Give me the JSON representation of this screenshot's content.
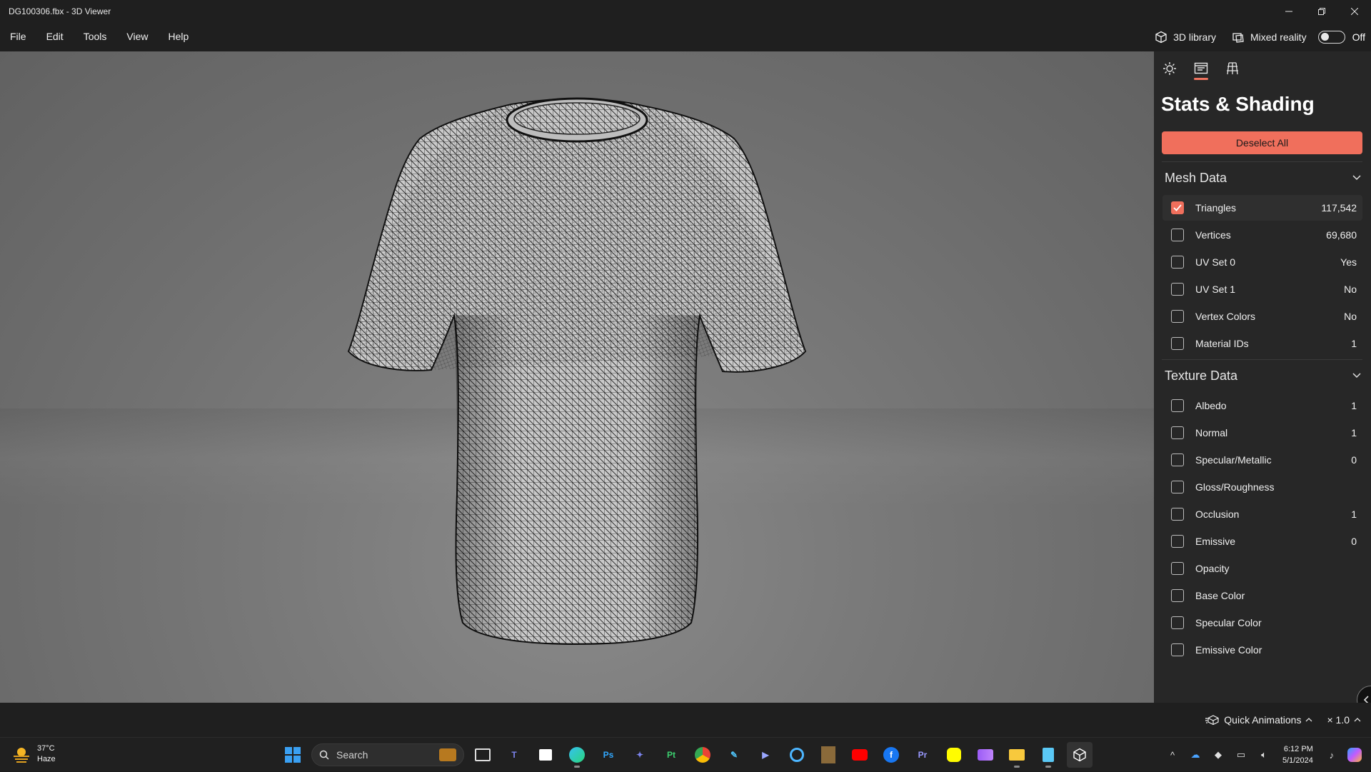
{
  "window": {
    "title": "DG100306.fbx - 3D Viewer"
  },
  "menu": {
    "items": [
      "File",
      "Edit",
      "Tools",
      "View",
      "Help"
    ]
  },
  "toolbar": {
    "library_label": "3D library",
    "mixed_reality_label": "Mixed reality",
    "toggle_state": "Off"
  },
  "panel": {
    "title": "Stats & Shading",
    "deselect_label": "Deselect All",
    "mesh_section": {
      "title": "Mesh Data",
      "rows": [
        {
          "label": "Triangles",
          "value": "117,542",
          "checked": true
        },
        {
          "label": "Vertices",
          "value": "69,680",
          "checked": false
        },
        {
          "label": "UV Set 0",
          "value": "Yes",
          "checked": false
        },
        {
          "label": "UV Set 1",
          "value": "No",
          "checked": false
        },
        {
          "label": "Vertex Colors",
          "value": "No",
          "checked": false
        },
        {
          "label": "Material IDs",
          "value": "1",
          "checked": false
        }
      ]
    },
    "texture_section": {
      "title": "Texture Data",
      "rows": [
        {
          "label": "Albedo",
          "value": "1",
          "checked": false
        },
        {
          "label": "Normal",
          "value": "1",
          "checked": false
        },
        {
          "label": "Specular/Metallic",
          "value": "0",
          "checked": false
        },
        {
          "label": "Gloss/Roughness",
          "value": "",
          "checked": false
        },
        {
          "label": "Occlusion",
          "value": "1",
          "checked": false
        },
        {
          "label": "Emissive",
          "value": "0",
          "checked": false
        },
        {
          "label": "Opacity",
          "value": "",
          "checked": false
        },
        {
          "label": "Base Color",
          "value": "",
          "checked": false
        },
        {
          "label": "Specular Color",
          "value": "",
          "checked": false
        },
        {
          "label": "Emissive Color",
          "value": "",
          "checked": false
        }
      ]
    }
  },
  "bottombar": {
    "quick_animations": "Quick Animations",
    "speed": "× 1.0"
  },
  "taskbar": {
    "weather_temp": "37°C",
    "weather_desc": "Haze",
    "search_label": "Search",
    "time": "6:12 PM",
    "date": "5/1/2024"
  },
  "colors": {
    "accent": "#f06f5c",
    "panel_bg": "#272727",
    "chrome_bg": "#1f1f1f"
  }
}
